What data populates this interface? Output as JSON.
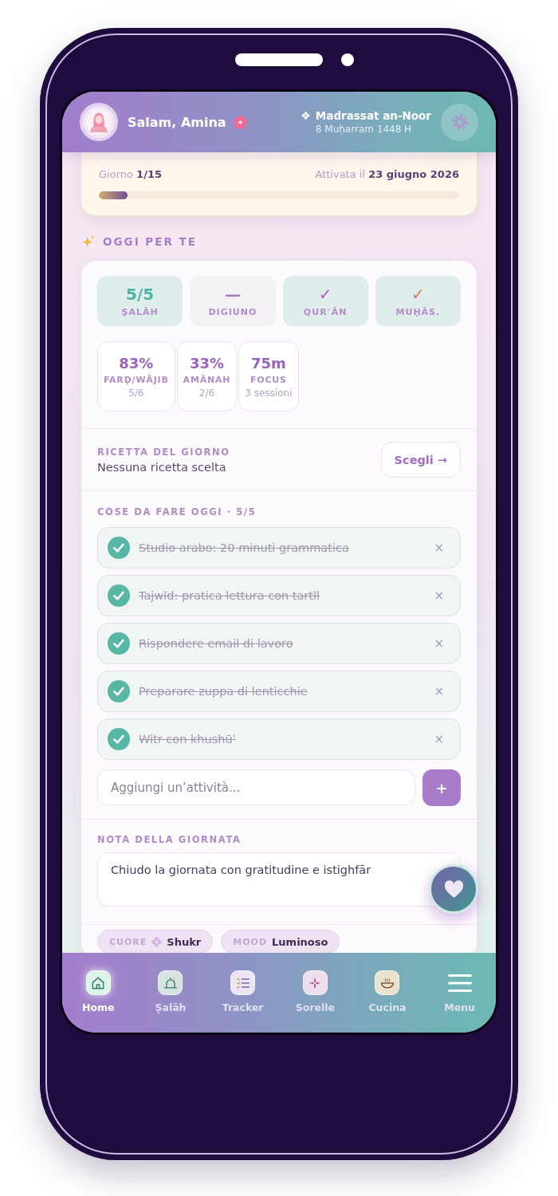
{
  "header": {
    "greeting": "Salam, Amina",
    "school_mark": "❖",
    "school": "Madrassat an-Noor",
    "date": "8 Muḥarram 1448 H"
  },
  "plan": {
    "day": "Giorno **1/15**",
    "activated": "Attivata il **23 giugno 2026**",
    "level": 0.08
  },
  "today": {
    "title": "OGGI PER TE"
  },
  "habits": [
    {
      "value": "5/5",
      "label": "ṢALĀH",
      "done": true,
      "color": "#4fb3a0"
    },
    {
      "value": "—",
      "label": "DIGIUNO",
      "done": false,
      "color": "#a77cc6"
    },
    {
      "value": "✓",
      "label": "QURʾĀN",
      "done": true,
      "color": "#a066c8"
    },
    {
      "value": "✓",
      "label": "MUḤĀS.",
      "done": true,
      "color": "#c8875e"
    }
  ],
  "stats": [
    {
      "value": "83%",
      "label": "FARḌ/WĀJIB",
      "sub": "5/6"
    },
    {
      "value": "33%",
      "label": "AMĀNAH",
      "sub": "2/6"
    },
    {
      "value": "75m",
      "label": "FOCUS",
      "sub": "3 sessioni"
    }
  ],
  "recipe": {
    "title": "RICETTA DEL GIORNO",
    "text": "Nessuna ricetta scelta",
    "button": "Scegli →"
  },
  "todos": {
    "title": "COSE DA FARE OGGI · 5/5",
    "items": [
      {
        "text": "Studio arabo: 20 minuti grammatica",
        "done": true,
        "remove": "×"
      },
      {
        "text": "Tajwīd: pratica lettura con tartīl",
        "done": true,
        "remove": "×"
      },
      {
        "text": "Rispondere email di lavoro",
        "done": true,
        "remove": "×"
      },
      {
        "text": "Preparare zuppa di lenticchie",
        "done": true,
        "remove": "×"
      },
      {
        "text": "Witr con khushūʿ",
        "done": true,
        "remove": "×"
      }
    ],
    "placeholder": "Aggiungi un’attività...",
    "add_button": "+"
  },
  "note": {
    "title": "NOTA DELLA GIORNATA",
    "value": "Chiudo la giornata con gratitudine e istighfār"
  },
  "chips": [
    {
      "label": "CUORE",
      "value": "Shukr"
    },
    {
      "label": "MOOD",
      "value": "Luminoso"
    }
  ],
  "nav": {
    "items": [
      {
        "label": "Home",
        "selected": true
      },
      {
        "label": "Ṣalāh",
        "selected": false
      },
      {
        "label": "Tracker",
        "selected": false
      },
      {
        "label": "Sorelle",
        "selected": false
      },
      {
        "label": "Cucina",
        "selected": false
      },
      {
        "label": "Menu",
        "selected": false
      }
    ]
  }
}
